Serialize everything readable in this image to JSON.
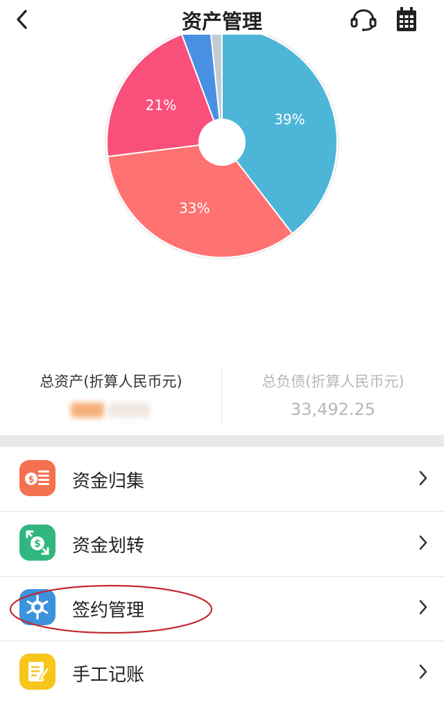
{
  "header": {
    "title": "资产管理",
    "back_icon": "chevron-left-icon",
    "service_icon": "headset-icon",
    "calendar_icon": "calendar-icon"
  },
  "chart_data": {
    "type": "pie",
    "donut": true,
    "slices": [
      {
        "label": "39%",
        "value": 39,
        "color": "#4db6d8"
      },
      {
        "label": "33%",
        "value": 33,
        "color": "#ff7272"
      },
      {
        "label": "21%",
        "value": 21,
        "color": "#f9507b"
      },
      {
        "label": "",
        "value": 4,
        "color": "#4a90e2"
      },
      {
        "label": "",
        "value": 1.6,
        "color": "#c3ccd3"
      }
    ]
  },
  "summary": {
    "total_assets_label": "总资产(折算人民币元)",
    "total_assets_value": "",
    "total_liabilities_label": "总负债(折算人民币元)",
    "total_liabilities_value": "33,492.25"
  },
  "menu": {
    "items": [
      {
        "label": "资金归集",
        "icon": "coins-icon",
        "color": "#f47150"
      },
      {
        "label": "资金划转",
        "icon": "transfer-icon",
        "color": "#32b680"
      },
      {
        "label": "签约管理",
        "icon": "gear-icon",
        "color": "#3c93dd"
      },
      {
        "label": "手工记账",
        "icon": "notepad-icon",
        "color": "#f7c61b"
      }
    ]
  },
  "colors": {
    "title": "#222222",
    "muted": "#b7b7b7",
    "highlight": "#c4272f"
  }
}
